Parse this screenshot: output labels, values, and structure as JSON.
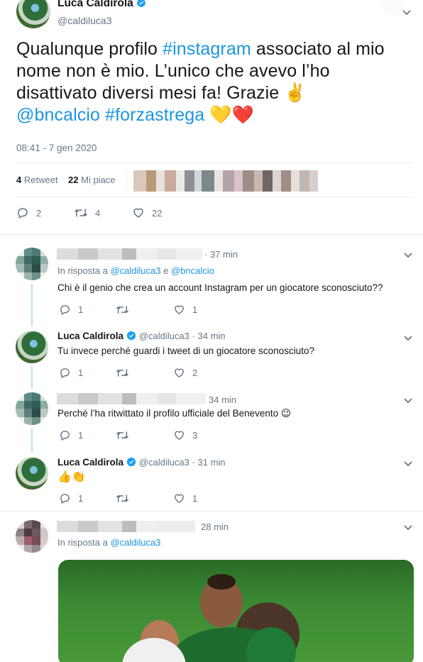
{
  "main_tweet": {
    "author_name": "Luca Caldirola",
    "author_handle": "@caldiluca3",
    "text_parts": {
      "p1": "Qualunque profilo ",
      "h1": "#instagram",
      "p2": " associato al mio nome non è mio. L’unico che avevo l’ho disattivato diversi mesi fa! Grazie ✌️",
      "m1": "@bncalcio",
      "p3": " ",
      "h2": "#forzastrega",
      "p4": " 💛❤️"
    },
    "timestamp": "08:41 - 7 gen 2020",
    "retweets_count": "4",
    "retweets_label": "Retweet",
    "likes_count": "22",
    "likes_label": "Mi piace",
    "actions": {
      "replies": "2",
      "retweets": "4",
      "likes": "22"
    }
  },
  "replies": [
    {
      "author_time": "· 37 min",
      "in_reply_prefix": "In risposta a",
      "in_reply_user1": "@caldiluca3",
      "in_reply_and": "e",
      "in_reply_user2": "@bncalcio",
      "text": "Chi è il genio che crea un account Instagram per un giocatore sconosciuto??",
      "replies": "1",
      "retweets": "",
      "likes": "1"
    },
    {
      "author_name": "Luca Caldirola",
      "author_handle": "@caldiluca3",
      "author_time": "· 34 min",
      "text": "Tu invece perché guardi i tweet di un giocatore sconosciuto?",
      "replies": "1",
      "retweets": "",
      "likes": "2"
    },
    {
      "author_time": "34 min",
      "text": "Perché l’ha ritwittato il profilo ufficiale del Benevento 😉",
      "replies": "1",
      "retweets": "",
      "likes": "3"
    },
    {
      "author_name": "Luca Caldirola",
      "author_handle": "@caldiluca3",
      "author_time": "· 31 min",
      "text": "👍👏",
      "replies": "1",
      "retweets": "",
      "likes": "1"
    },
    {
      "author_time": "28 min",
      "in_reply_prefix": "In risposta a",
      "in_reply_user1": "@caldiluca3"
    }
  ],
  "colors": {
    "link": "#1b95e0",
    "muted": "#657786",
    "thread": "#b3e2f3",
    "verified": "#1da1f2",
    "heart": "#e0245e"
  }
}
